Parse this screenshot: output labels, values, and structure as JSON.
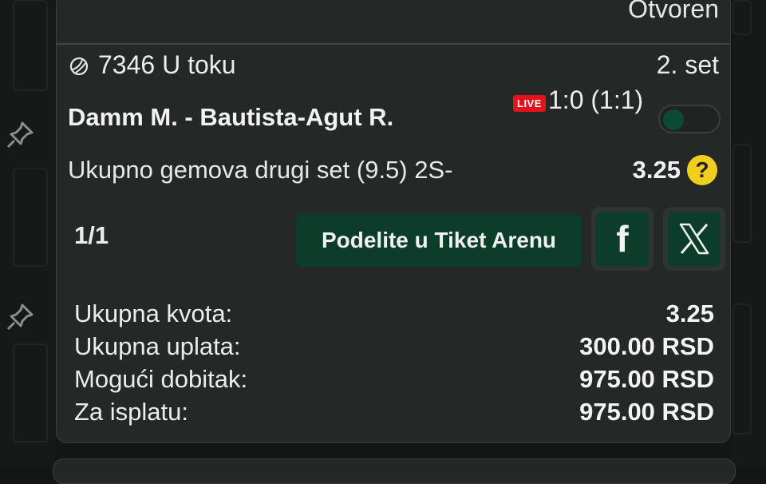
{
  "ticket": {
    "status": "Otvoren",
    "event_code": "7346 U toku",
    "period": "2. set",
    "match": "Damm M. - Bautista-Agut R.",
    "live_badge": "LIVE",
    "score": "1:0 (1:1)",
    "market": "Ukupno gemova drugi set (9.5) 2S-",
    "odds": "3.25",
    "help_symbol": "?",
    "count": "1/1",
    "share_label": "Podelite u Tiket Arenu",
    "facebook_icon": "f",
    "summary": [
      {
        "label": "Ukupna kvota:",
        "value": "3.25"
      },
      {
        "label": "Ukupna uplata:",
        "value": "300.00 RSD"
      },
      {
        "label": "Mogući dobitak:",
        "value": "975.00 RSD"
      },
      {
        "label": "Za isplatu:",
        "value": "975.00 RSD"
      }
    ]
  },
  "colors": {
    "background": "#121614",
    "card": "#242827",
    "accent_green": "#0c3d2b",
    "live_red": "#e3131b",
    "help_yellow": "#f2cf1f"
  },
  "icons": [
    "tennis-ball-icon",
    "pin-icon",
    "facebook-icon",
    "x-icon",
    "help-icon"
  ]
}
